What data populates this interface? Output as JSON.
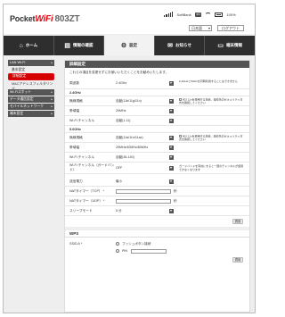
{
  "brand": {
    "pocket": "Pocket",
    "wifi": "WiFi",
    "model": "803ZT"
  },
  "status": {
    "carrier": "SoftBank",
    "network": "4G",
    "battery": "100%"
  },
  "header": {
    "language": "日本語",
    "logout": "ログアウト"
  },
  "nav": {
    "tabs": [
      {
        "label": "ホーム",
        "icon": "home-icon"
      },
      {
        "label": "情報の確認",
        "icon": "info-icon"
      },
      {
        "label": "設定",
        "icon": "gear-icon"
      },
      {
        "label": "お知らせ",
        "icon": "mail-icon"
      },
      {
        "label": "端末情報",
        "icon": "device-icon"
      }
    ]
  },
  "sidebar": {
    "lan": "LAN Wi-Fi",
    "sub1": "基本設定",
    "sub2": "詳細設定",
    "sub3": "MACアドレスフィルタリング",
    "wifi_spot": "Wi-Fiスポット",
    "data": "データ通信設定",
    "mobile": "モバイルネットワーク",
    "device": "端末設定"
  },
  "detail": {
    "title": "詳細設定",
    "desc": "これらの項目を変更せずにお使いいただくことをお勧めいたします。",
    "band_label": "周波数",
    "band_value": "2.4GHz",
    "band_note": "2.4GHzと5GHzを同時利用することはできません",
    "g24_header": "2.4GHz",
    "g24_mode_label": "無線規格",
    "g24_mode_value": "自動(11b/11g/11n)",
    "g24_mode_note": "802.11nを使用する場合、接続先のセキュリティ方式を確認してください",
    "g24_bw_label": "帯域幅",
    "g24_bw_value": "20MHz",
    "g24_ch_label": "Wi-Fi チャンネル",
    "g24_ch_value": "自動(1-11)",
    "g5_header": "5.0GHz",
    "g5_mode_label": "無線規格",
    "g5_mode_value": "自動(11a/11n/11ac)",
    "g5_mode_note": "802.11nを使用する場合、接続先のセキュリティ方式を確認してください",
    "g5_bw_label": "帯域幅",
    "g5_bw_value": "20MHz/40MHz/80MHz",
    "g5_ch_label": "Wi-Fi チャンネル",
    "g5_ch_value": "自動(36-140)",
    "guard_label": "Wi-Fi チャンネル（ガードバンド）",
    "guard_value": "OFF",
    "guard_note": "ガードバンドを有効にすると一部のチャンネルが使用できなくなります",
    "power_label": "送信電力",
    "power_value": "最小",
    "nat_tcp_label": "NATタイマー（TCP） *",
    "nat_tcp_unit": "秒",
    "nat_udp_label": "NATタイマー（UDP） *",
    "nat_udp_unit": "秒",
    "sleep_label": "スリープモード",
    "sleep_value": "5 分",
    "apply": "適用"
  },
  "wps": {
    "title": "WPS",
    "ssid_label": "SSID A *",
    "push": "プッシュボタン接続",
    "pin": "PIN",
    "apply": "適用"
  }
}
